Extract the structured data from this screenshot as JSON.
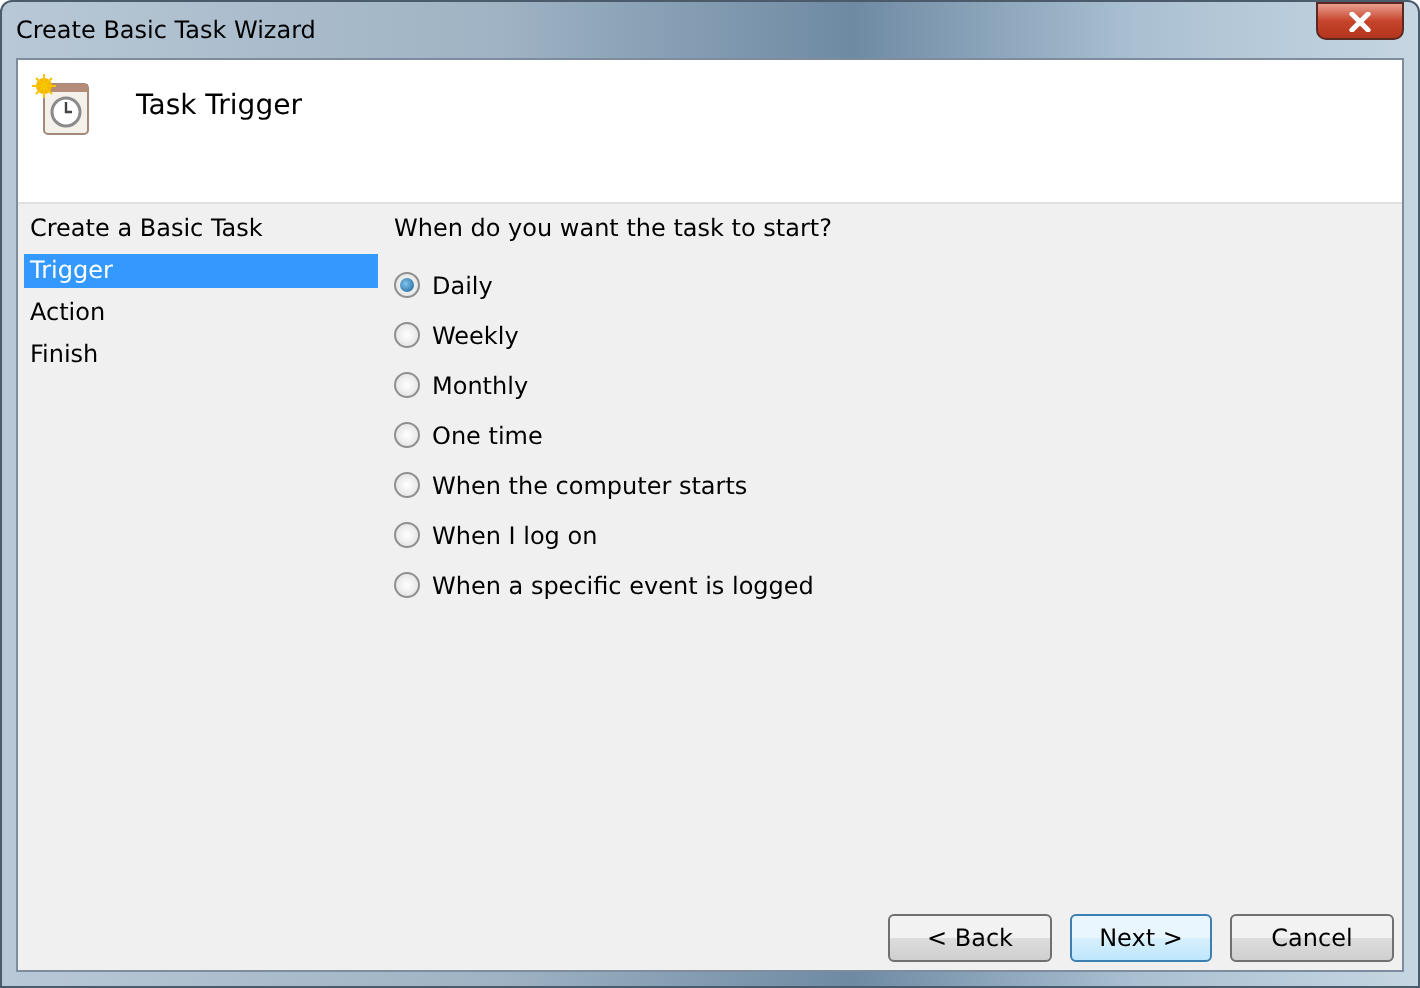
{
  "window": {
    "title": "Create Basic Task Wizard"
  },
  "header": {
    "title": "Task Trigger"
  },
  "sidebar": {
    "items": [
      {
        "label": "Create a Basic Task",
        "selected": false
      },
      {
        "label": "Trigger",
        "selected": true
      },
      {
        "label": "Action",
        "selected": false
      },
      {
        "label": "Finish",
        "selected": false
      }
    ]
  },
  "question": "When do you want the task to start?",
  "options": [
    {
      "label": "Daily",
      "selected": true
    },
    {
      "label": "Weekly",
      "selected": false
    },
    {
      "label": "Monthly",
      "selected": false
    },
    {
      "label": "One time",
      "selected": false
    },
    {
      "label": "When the computer starts",
      "selected": false
    },
    {
      "label": "When I log on",
      "selected": false
    },
    {
      "label": "When a specific event is logged",
      "selected": false
    }
  ],
  "buttons": [
    {
      "label": "< Back",
      "kind": "normal"
    },
    {
      "label": "Next >",
      "kind": "default"
    },
    {
      "label": "Cancel",
      "kind": "normal"
    }
  ]
}
